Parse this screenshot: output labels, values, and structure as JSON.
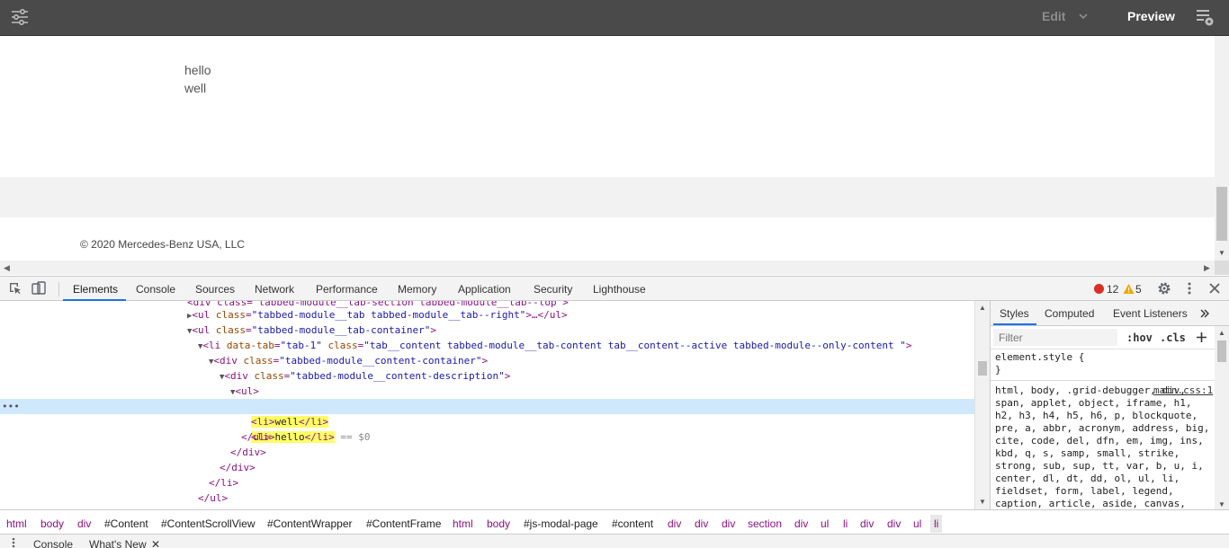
{
  "topbar": {
    "edit_label": "Edit",
    "preview_label": "Preview"
  },
  "page": {
    "list_items": [
      "hello",
      "well"
    ],
    "copyright": "© 2020 Mercedes-Benz USA, LLC"
  },
  "devtools": {
    "tabs": [
      "Elements",
      "Console",
      "Sources",
      "Network",
      "Performance",
      "Memory",
      "Application",
      "Security",
      "Lighthouse"
    ],
    "active_tab": "Elements",
    "error_count": "12",
    "warning_count": "5",
    "tree": {
      "line0": "<div class=\"tabbed-module__tab-section tabbed-module__tab--top\">",
      "line1_tag_open": "<ul",
      "line1_attr": "class",
      "line1_val": "\"tabbed-module__tab tabbed-module__tab--right\"",
      "line1_tail": ">…</ul>",
      "line2_val": "\"tabbed-module__tab-container\"",
      "line3_attr1": "data-tab",
      "line3_val1": "\"tab-1\"",
      "line3_val2": "\"tab__content tabbed-module__tab-content tab__content--active tabbed-module--only-content \"",
      "line4_val": "\"tabbed-module__content-container\"",
      "line5_val": "\"tabbed-module__content-description\"",
      "ul_open": "<ul>",
      "li1_text": "hello",
      "li2_text": "well",
      "selected_marker": "== $0",
      "ul_close": "</ul>",
      "div_close": "</div>",
      "li_close": "</li>",
      "li_close_tag": "</li>",
      "li_open_tag": "<li>"
    },
    "styles": {
      "tabs": [
        "Styles",
        "Computed",
        "Event Listeners"
      ],
      "filter_placeholder": "Filter",
      "hov_label": ":hov",
      "cls_label": ".cls",
      "element_style_open": "element.style {",
      "element_style_close": "}",
      "main_rule_selector": "html, body, .grid-debugger, div, span, applet, object, iframe, h1, h2, h3, h4, h5, h6, p, blockquote, pre, a, abbr, acronym, address, big, cite, code, del, dfn, em, img, ins, kbd, q, s, samp, small, strike, strong, sub, sup, tt, var, b, u, i, center, dl, dt, dd, ol, ul, li, fieldset, form, label, legend, caption, article, aside, canvas, details, embed, figure, figcaption, footer, header, hgroup,",
      "main_rule_source": "main.css:1"
    },
    "breadcrumbs": [
      "html",
      "body",
      "div",
      "#Content",
      "#ContentScrollView",
      "#ContentWrapper",
      "#ContentFrame",
      "html",
      "body",
      "#js-modal-page",
      "#content",
      "div",
      "div",
      "div",
      "section",
      "div",
      "ul",
      "li",
      "div",
      "div",
      "ul",
      "li"
    ],
    "drawer_tabs": [
      "Console",
      "What's New"
    ]
  }
}
